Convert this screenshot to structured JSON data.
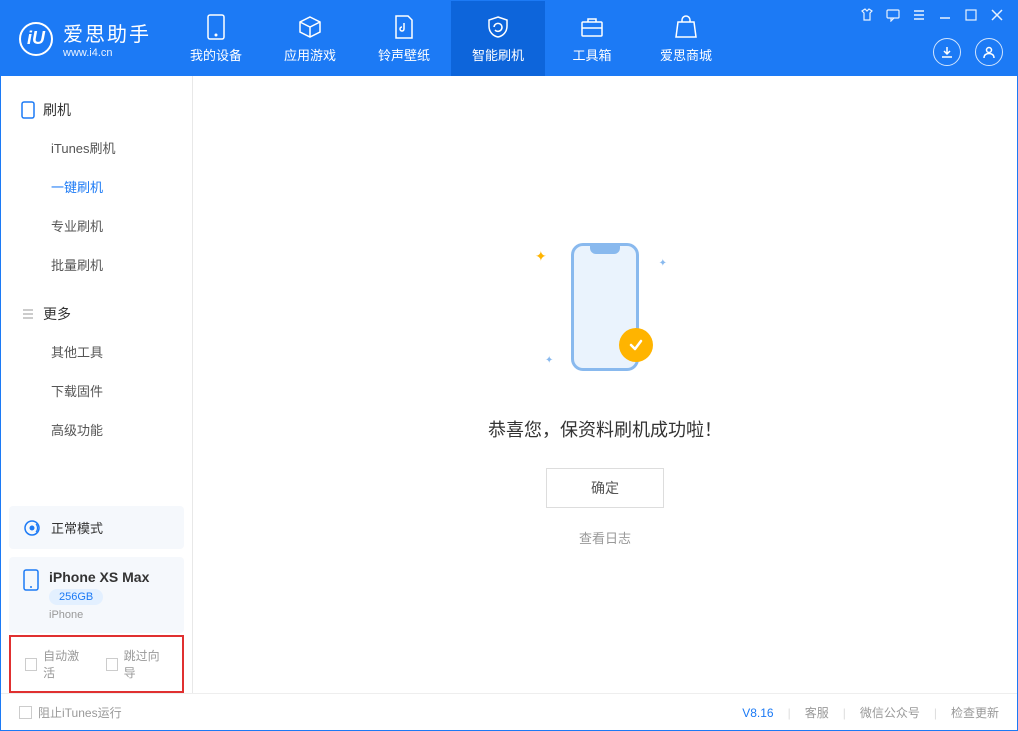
{
  "app": {
    "title": "爱思助手",
    "subtitle": "www.i4.cn"
  },
  "tabs": {
    "my_device": "我的设备",
    "apps_games": "应用游戏",
    "ring_wall": "铃声壁纸",
    "smart_flash": "智能刷机",
    "toolbox": "工具箱",
    "store": "爱思商城"
  },
  "sidebar": {
    "section_flash": "刷机",
    "items_flash": [
      "iTunes刷机",
      "一键刷机",
      "专业刷机",
      "批量刷机"
    ],
    "section_more": "更多",
    "items_more": [
      "其他工具",
      "下载固件",
      "高级功能"
    ]
  },
  "device": {
    "mode": "正常模式",
    "name": "iPhone XS Max",
    "storage": "256GB",
    "type": "iPhone"
  },
  "checkboxes": {
    "auto_activate": "自动激活",
    "skip_guide": "跳过向导"
  },
  "main": {
    "success_msg": "恭喜您，保资料刷机成功啦！",
    "ok": "确定",
    "view_log": "查看日志"
  },
  "footer": {
    "block_itunes": "阻止iTunes运行",
    "version": "V8.16",
    "customer_service": "客服",
    "wechat": "微信公众号",
    "check_update": "检查更新"
  }
}
